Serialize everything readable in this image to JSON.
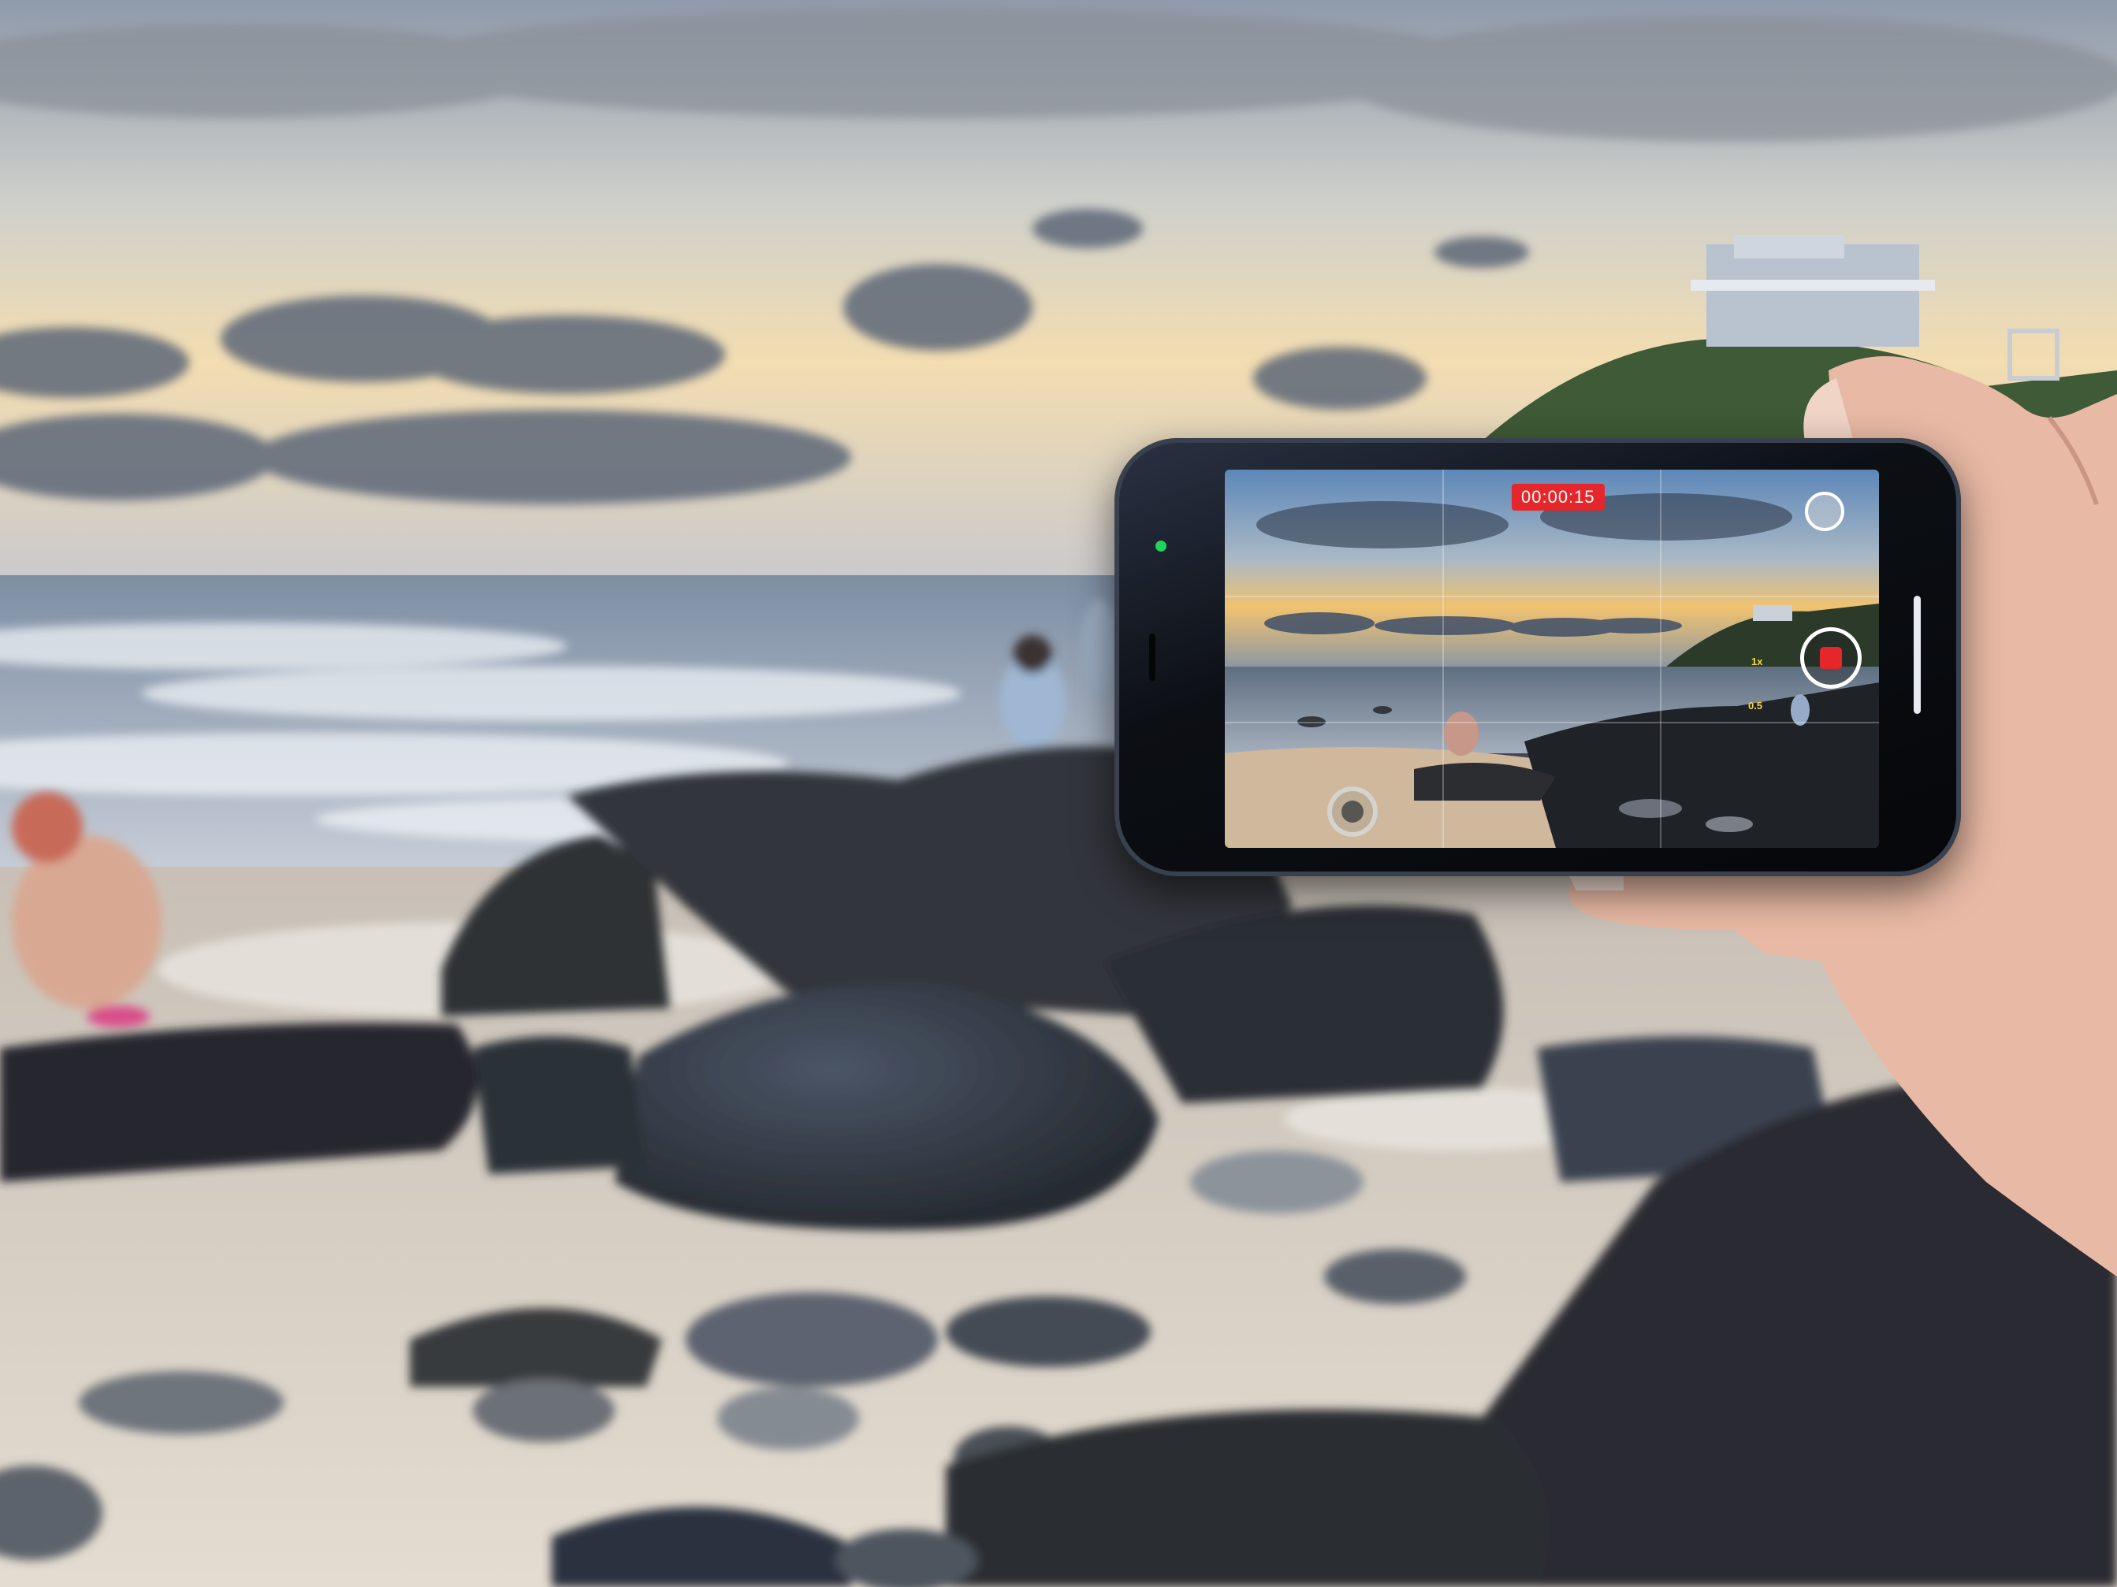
{
  "scene": {
    "subject": "beach-at-sunset-with-rocks",
    "colors": {
      "sky_top": "#9aa6b6",
      "sky_glow": "#f2dcae",
      "sea": "#8fa0b3",
      "sand": "#d8cfc4",
      "rock": "#2e3136",
      "hill": "#3e5a36"
    }
  },
  "phone": {
    "recording_timer": "00:00:15",
    "zoom_labels": [
      "1x",
      "0.5"
    ],
    "record_button_color": "#e5262a",
    "icons": [
      "flip-camera-icon",
      "record-stop-icon",
      "focus-ring-icon"
    ]
  }
}
